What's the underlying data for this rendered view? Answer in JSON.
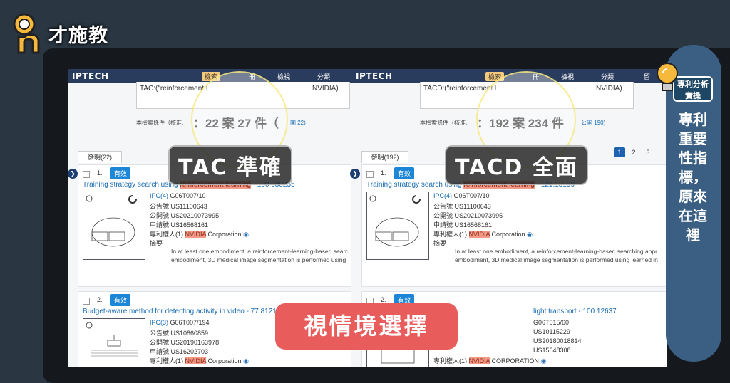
{
  "logo": {
    "text": "才施教"
  },
  "brand": "IPTECH",
  "nav": {
    "search": "檢索",
    "list": "冊",
    "view": "檢視",
    "classify": "分類",
    "more": "留"
  },
  "left": {
    "query": "TAC:(\"reinforcement learning\" and NVIDIA)",
    "query_visible_left": "TAC:(\"reinforcement l",
    "query_visible_right": "NVIDIA)",
    "count_prefix": "本檢索條件（核准,",
    "count_big": "：22 案  27 件（",
    "count_suffix": "開 22)",
    "tab": "發明(22)",
    "cards": [
      {
        "num": "1.",
        "badge": "有效",
        "title_pre": "Training strategy search using ",
        "title_hl": "reinforcement learning",
        "title_post": " - 100 980255",
        "meta": [
          {
            "label": "IPC(4) ",
            "value": "G06T007/10"
          },
          {
            "label": "公告號 ",
            "value": "US11100643"
          },
          {
            "label": "公開號 ",
            "value": "US20210073995"
          },
          {
            "label": "申請號 ",
            "value": "US16568161"
          }
        ],
        "assignee_label": "專利權人(1) ",
        "assignee_hl": "NVIDIA",
        "assignee_post": " Corporation",
        "abstract_label": "摘要",
        "abstract1": "In at least one embodiment, a reinforcement-learning-based searc",
        "abstract2": "embodiment, 3D medical image segmentation is performed using"
      },
      {
        "num": "2.",
        "badge": "有效",
        "title_pre": "Budget-aware method for detecting activity in video - 77 81216",
        "meta": [
          {
            "label": "IPC(3) ",
            "value": "G06T007/194"
          },
          {
            "label": "公告號 ",
            "value": "US10860859"
          },
          {
            "label": "公開號 ",
            "value": "US20190163978"
          },
          {
            "label": "申請號 ",
            "value": "US16202703"
          }
        ],
        "assignee_label": "專利權人(1) ",
        "assignee_hl": "NVIDIA",
        "assignee_post": " Corporation"
      }
    ]
  },
  "right": {
    "query_visible_left": "TACD:(\"reinforcement l",
    "query_visible_right": "NVIDIA)",
    "count_prefix": "本檢索條件（核准,",
    "count_big": "：192 案  234 件",
    "count_suffix": "公開 190)",
    "tab": "發明(192)",
    "pager": [
      "1",
      "2",
      "3"
    ],
    "cards": [
      {
        "num": "1.",
        "badge": "有效",
        "title_pre": "Training strategy search using ",
        "title_hl": "reinforcement learning",
        "title_post": " - 121.13199",
        "meta": [
          {
            "label": "IPC(4) ",
            "value": "G06T007/10"
          },
          {
            "label": "公告號 ",
            "value": "US11100643"
          },
          {
            "label": "公開號 ",
            "value": "US20210073995"
          },
          {
            "label": "申請號 ",
            "value": "US16568161"
          }
        ],
        "assignee_label": "專利權人(1) ",
        "assignee_hl": "NVIDIA",
        "assignee_post": " Corporation",
        "abstract_label": "摘要",
        "abstract1": "In at least one embodiment, a reinforcement-learning-based searching appr",
        "abstract2": "embodiment, 3D medical image segmentation is performed using learned in"
      },
      {
        "num": "2.",
        "badge": "有效",
        "title_pre": "light transport - 100 12637",
        "meta": [
          {
            "label": "",
            "value": "G06T015/60"
          },
          {
            "label": "",
            "value": "US10115229"
          },
          {
            "label": "",
            "value": "US20180018814"
          },
          {
            "label": "",
            "value": "US15648308"
          }
        ],
        "assignee_label": "專利權人(1) ",
        "assignee_hl": "NVIDIA",
        "assignee_post": " CORPORATION"
      }
    ]
  },
  "overlays": {
    "tac": "TAC 準確",
    "tacd": "TACD 全面",
    "scenario": "視情境選擇"
  },
  "side": {
    "head_line1": "專利分析",
    "head_line2": "實操",
    "vertical": "專利重要性指標，原來在這裡"
  },
  "colors": {
    "bg": "#2a3743",
    "navbar": "#2a3c5e",
    "badge": "#1e86d6",
    "highlight": "#f39a86",
    "side": "#3a5f82",
    "red": "#e85c5c"
  }
}
